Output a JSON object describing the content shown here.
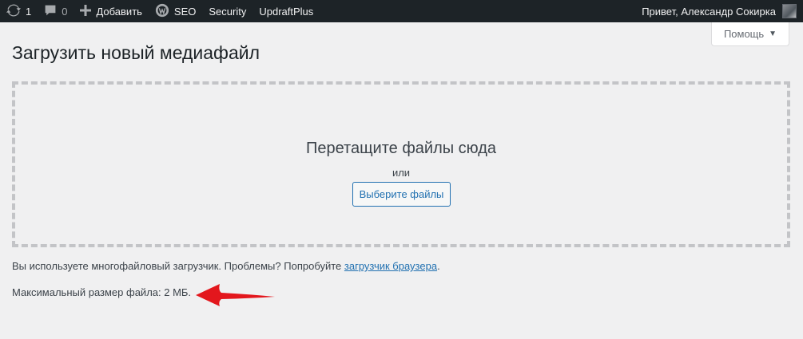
{
  "adminbar": {
    "updates_count": "1",
    "comments_count": "0",
    "add_new": "Добавить",
    "seo": "SEO",
    "security": "Security",
    "updraftplus": "UpdraftPlus",
    "greeting": "Привет, Александр Сокирка"
  },
  "help": {
    "label": "Помощь"
  },
  "page": {
    "title": "Загрузить новый медиафайл"
  },
  "dropzone": {
    "title": "Перетащите файлы сюда",
    "or": "или",
    "select_button": "Выберите файлы"
  },
  "info": {
    "multi_uploader_text": "Вы используете многофайловый загрузчик. Проблемы? Попробуйте ",
    "browser_uploader_link": "загрузчик браузера",
    "period": ".",
    "max_size": "Максимальный размер файла: 2 МБ."
  },
  "annotation": {
    "arrow_color": "#e3171d"
  }
}
